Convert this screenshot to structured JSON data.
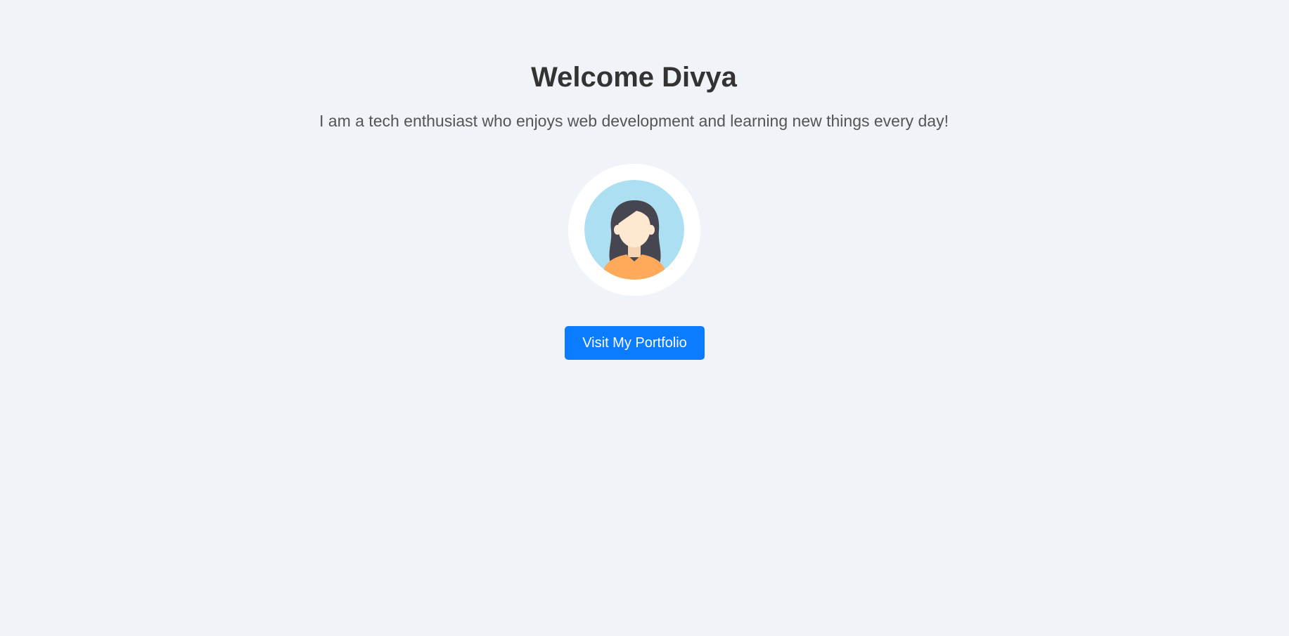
{
  "header": {
    "title": "Welcome Divya",
    "subtitle": "I am a tech enthusiast who enjoys web development and learning new things every day!"
  },
  "avatar": {
    "icon": "female-avatar-icon",
    "colors": {
      "ring": "#ffffff",
      "background": "#abdff1",
      "hair": "#464651",
      "skin": "#ffe8d0",
      "shirt": "#ffa95c"
    }
  },
  "actions": {
    "visit_portfolio_label": "Visit My Portfolio"
  },
  "theme": {
    "page_background": "#f0f3f7",
    "accent": "#0a7cff",
    "heading_color": "#333333",
    "text_color": "#555555"
  }
}
